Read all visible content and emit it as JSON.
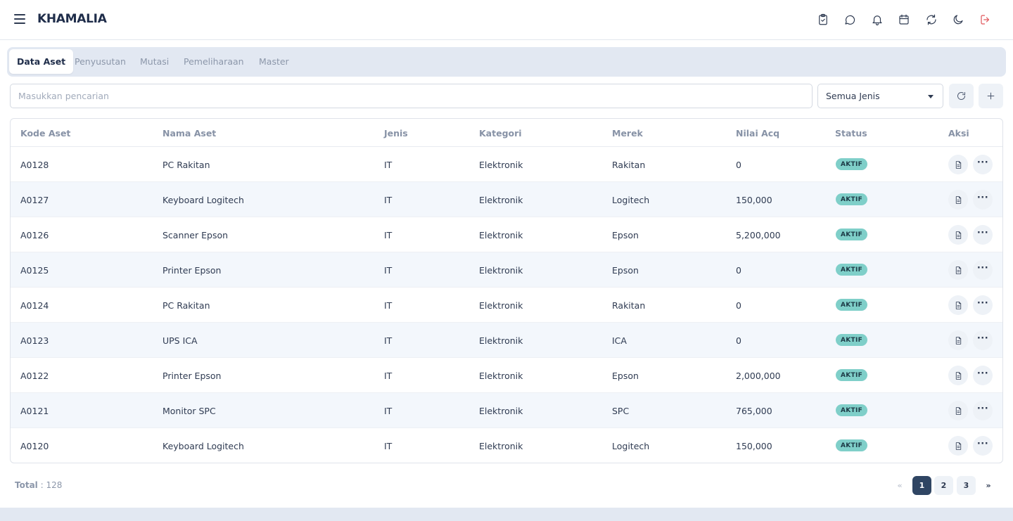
{
  "app": {
    "title": "KHAMALIA"
  },
  "header_icons": [
    "clipboard-check-icon",
    "chat-icon",
    "bell-icon",
    "calendar-icon",
    "sync-icon",
    "moon-icon",
    "logout-icon"
  ],
  "tabs": [
    {
      "label": "Data Aset",
      "active": true
    },
    {
      "label": "Penyusutan",
      "active": false
    },
    {
      "label": "Mutasi",
      "active": false
    },
    {
      "label": "Pemeliharaan",
      "active": false
    },
    {
      "label": "Master",
      "active": false
    }
  ],
  "search": {
    "placeholder": "Masukkan pencarian",
    "value": ""
  },
  "filter": {
    "selected": "Semua Jenis"
  },
  "table": {
    "columns": [
      "Kode Aset",
      "Nama Aset",
      "Jenis",
      "Kategori",
      "Merek",
      "Nilai Acq",
      "Status",
      "Aksi"
    ],
    "rows": [
      {
        "kode": "A0128",
        "nama": "PC Rakitan",
        "jenis": "IT",
        "kategori": "Elektronik",
        "merek": "Rakitan",
        "nilai": "0",
        "status": "AKTIF"
      },
      {
        "kode": "A0127",
        "nama": "Keyboard Logitech",
        "jenis": "IT",
        "kategori": "Elektronik",
        "merek": "Logitech",
        "nilai": "150,000",
        "status": "AKTIF"
      },
      {
        "kode": "A0126",
        "nama": "Scanner Epson",
        "jenis": "IT",
        "kategori": "Elektronik",
        "merek": "Epson",
        "nilai": "5,200,000",
        "status": "AKTIF"
      },
      {
        "kode": "A0125",
        "nama": "Printer Epson",
        "jenis": "IT",
        "kategori": "Elektronik",
        "merek": "Epson",
        "nilai": "0",
        "status": "AKTIF"
      },
      {
        "kode": "A0124",
        "nama": "PC Rakitan",
        "jenis": "IT",
        "kategori": "Elektronik",
        "merek": "Rakitan",
        "nilai": "0",
        "status": "AKTIF"
      },
      {
        "kode": "A0123",
        "nama": "UPS ICA",
        "jenis": "IT",
        "kategori": "Elektronik",
        "merek": "ICA",
        "nilai": "0",
        "status": "AKTIF"
      },
      {
        "kode": "A0122",
        "nama": "Printer Epson",
        "jenis": "IT",
        "kategori": "Elektronik",
        "merek": "Epson",
        "nilai": "2,000,000",
        "status": "AKTIF"
      },
      {
        "kode": "A0121",
        "nama": "Monitor SPC",
        "jenis": "IT",
        "kategori": "Elektronik",
        "merek": "SPC",
        "nilai": "765,000",
        "status": "AKTIF"
      },
      {
        "kode": "A0120",
        "nama": "Keyboard Logitech",
        "jenis": "IT",
        "kategori": "Elektronik",
        "merek": "Logitech",
        "nilai": "150,000",
        "status": "AKTIF"
      }
    ]
  },
  "footer": {
    "total_label": "Total",
    "total_value": ": 128",
    "pagination": {
      "prev": "«",
      "pages": [
        "1",
        "2",
        "3"
      ],
      "current": "1",
      "next": "»"
    }
  },
  "colors": {
    "primary": "#2f4563",
    "badge": "#7fcfc9",
    "logout": "#e0565a",
    "tabs_bg": "#e2e8f2",
    "row_alt": "#f3f7fc"
  }
}
